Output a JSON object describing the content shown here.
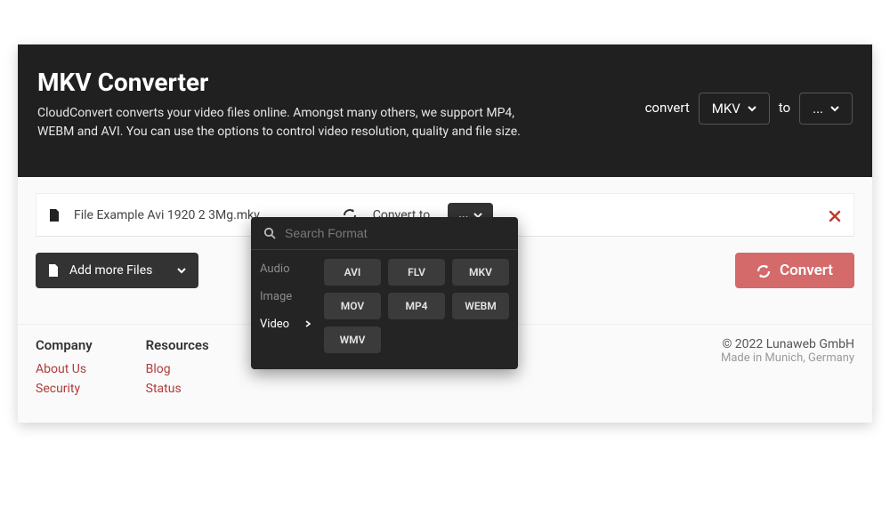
{
  "header": {
    "title": "MKV Converter",
    "description": "CloudConvert converts your video files online. Amongst many others, we support MP4, WEBM and AVI. You can use the options to control video resolution, quality and file size.",
    "convert_label": "convert",
    "from_value": "MKV",
    "to_label": "to",
    "to_value": "..."
  },
  "file": {
    "name": "File Example Avi 1920 2 3Mg.mkv",
    "convert_to_label": "Convert to",
    "target_value": "..."
  },
  "actions": {
    "add_more": "Add more Files",
    "convert": "Convert"
  },
  "dropdown": {
    "search_placeholder": "Search Format",
    "categories": [
      "Audio",
      "Image",
      "Video"
    ],
    "active_category": "Video",
    "formats": [
      "AVI",
      "FLV",
      "MKV",
      "MOV",
      "MP4",
      "WEBM",
      "WMV"
    ]
  },
  "footer": {
    "company_heading": "Company",
    "company_links": [
      "About Us",
      "Security"
    ],
    "resources_heading": "Resources",
    "resources_links": [
      "Blog",
      "Status"
    ],
    "copyright": "© 2022 Lunaweb GmbH",
    "madein": "Made in Munich, Germany"
  }
}
